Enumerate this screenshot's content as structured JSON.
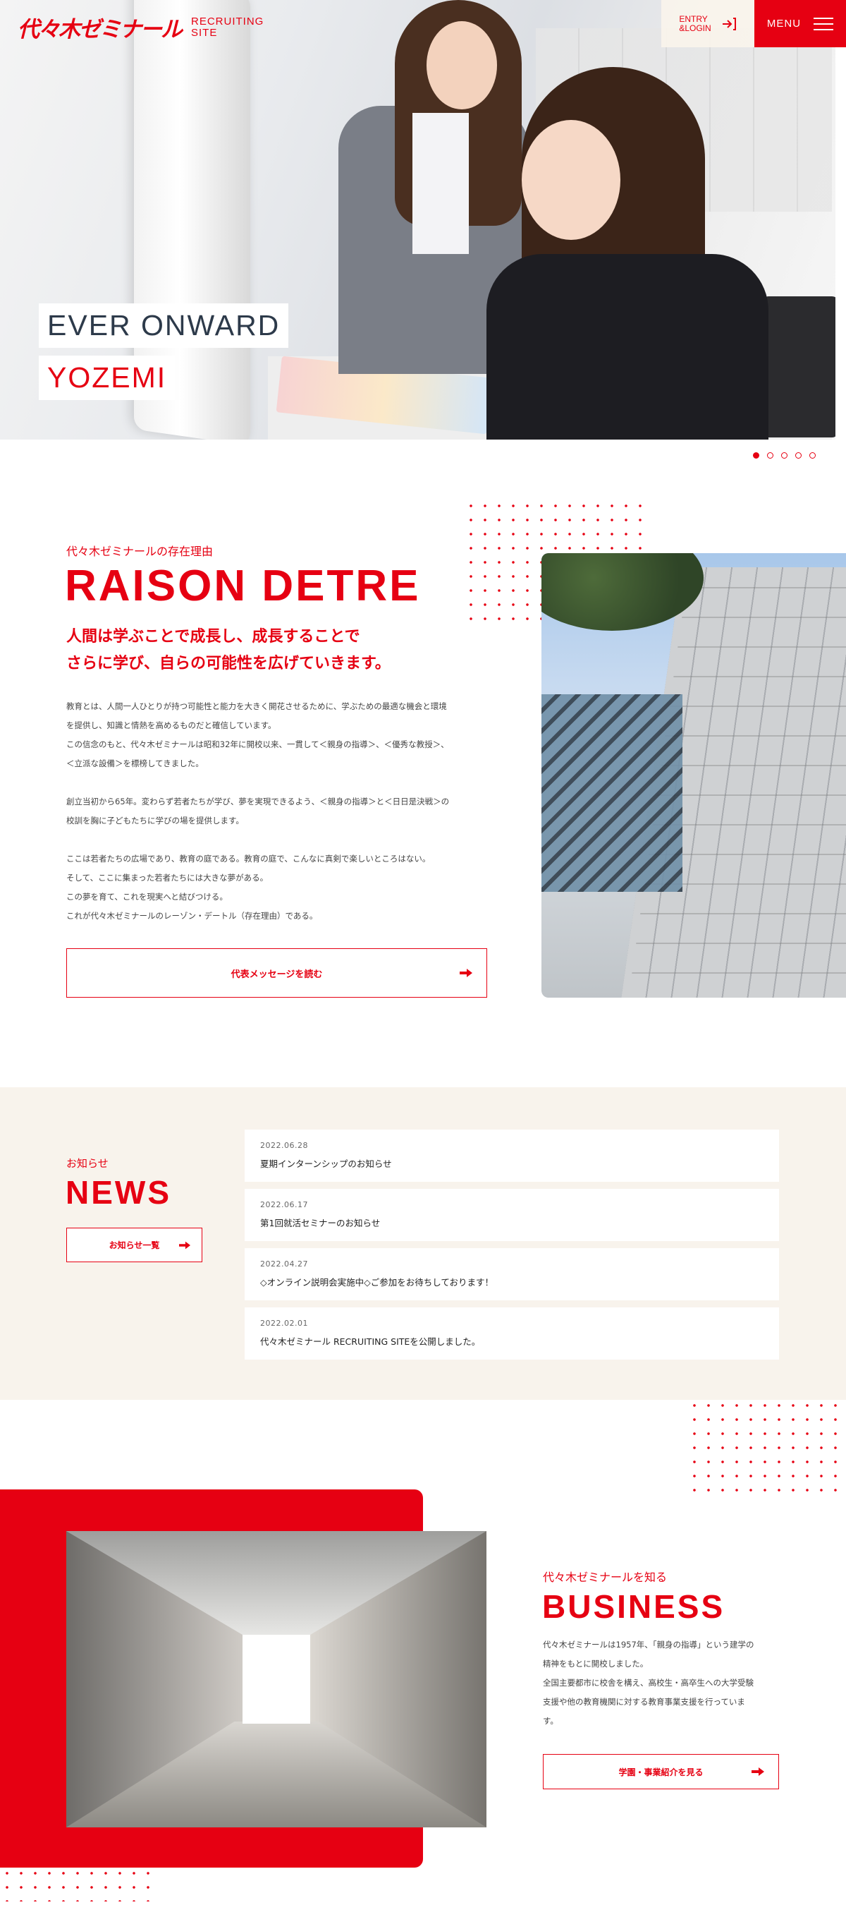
{
  "header": {
    "logo": "代々木ゼミナール",
    "logo_sub_line1": "RECRUITING",
    "logo_sub_line2": "SITE",
    "entry_line1": "ENTRY",
    "entry_line2": "&LOGIN",
    "menu_label": "MENU"
  },
  "hero": {
    "title_line1": "EVER ONWARD",
    "title_line2": "YOZEMI",
    "slide_count": 5,
    "active_slide": 1
  },
  "raison": {
    "subtitle": "代々木ゼミナールの存在理由",
    "title": "RAISON DETRE",
    "lead_line1": "人間は学ぶことで成長し、成長することで",
    "lead_line2": "さらに学び、自らの可能性を広げていきます。",
    "paragraphs": [
      [
        "教育とは、人間一人ひとりが持つ可能性と能力を大きく開花させるために、学ぶための最適な機会と環境",
        "を提供し、知識と情熱を高めるものだと確信しています。",
        "この信念のもと、代々木ゼミナールは昭和32年に開校以来、一貫して＜親身の指導＞、＜優秀な教授＞、",
        "＜立派な設備＞を標榜してきました。"
      ],
      [
        "創立当初から65年。変わらず若者たちが学び、夢を実現できるよう、＜親身の指導＞と＜日日是決戦＞の",
        "校訓を胸に子どもたちに学びの場を提供します。"
      ],
      [
        "ここは若者たちの広場であり、教育の庭である。教育の庭で、こんなに真剣で楽しいところはない。",
        "そして、ここに集まった若者たちには大きな夢がある。",
        "この夢を育て、これを現実へと結びつける。",
        "これが代々木ゼミナールのレーゾン・デートル（存在理由）である。"
      ]
    ],
    "button_label": "代表メッセージを読む"
  },
  "news": {
    "subtitle": "お知らせ",
    "title": "NEWS",
    "button_label": "お知らせ一覧",
    "items": [
      {
        "date": "2022.06.28",
        "text": "夏期インターンシップのお知らせ"
      },
      {
        "date": "2022.06.17",
        "text": "第1回就活セミナーのお知らせ"
      },
      {
        "date": "2022.04.27",
        "text": "◇オンライン説明会実施中◇ご参加をお待ちしております！"
      },
      {
        "date": "2022.02.01",
        "text": "代々木ゼミナール RECRUITING SITEを公開しました。"
      }
    ]
  },
  "business": {
    "subtitle": "代々木ゼミナールを知る",
    "title": "BUSINESS",
    "body_lines": [
      "代々木ゼミナールは1957年、「親身の指導」という建学の",
      "精神をもとに開校しました。",
      "全国主要都市に校舎を構え、高校生・高卒生への大学受験",
      "支援や他の教育機関に対する教育事業支援を行っていま",
      "す。"
    ],
    "button_label": "学園・事業紹介を見る"
  },
  "colors": {
    "brand_red": "#e60012",
    "beige": "#f8f3ec",
    "navy": "#2d3a4a"
  },
  "icons": {
    "entry": "login-arrow-icon",
    "menu": "hamburger-icon",
    "button_arrow": "arrow-right-icon"
  }
}
